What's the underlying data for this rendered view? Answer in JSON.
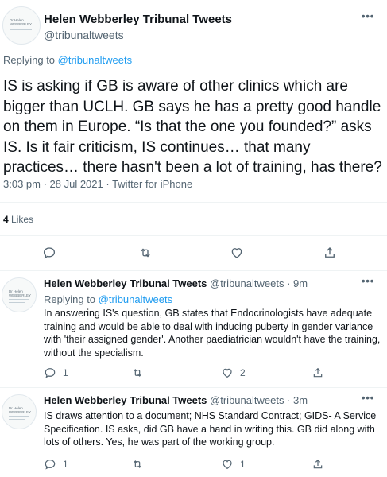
{
  "main_tweet": {
    "author_name": "Helen Webberley Tribunal Tweets",
    "author_handle": "@tribunaltweets",
    "avatar_text": "Dr Helen WEBBERLEY",
    "more_icon": "more-dots-icon",
    "replying_prefix": "Replying to",
    "replying_to": "@tribunaltweets",
    "text": "IS is asking if GB is aware of other clinics which are bigger than UCLH. GB says he has a pretty good handle on them in Europe. “Is that the one you founded?” asks IS. Is it fair criticism, IS continues… that many practices… there hasn't been a lot of training, has there?",
    "timestamp": "3:03 pm · 28 Jul 2021 · Twitter for iPhone",
    "likes_count": "4",
    "likes_label": "Likes",
    "actions": [
      "reply-icon",
      "retweet-icon",
      "like-icon",
      "share-icon"
    ]
  },
  "replies": [
    {
      "author_name": "Helen Webberley Tribunal Tweets",
      "author_handle": "@tribunaltweets",
      "time": "· 9m",
      "avatar_text": "Dr Helen WEBBERLEY",
      "replying_prefix": "Replying to",
      "replying_to": "@tribunaltweets",
      "text": "In answering IS's question, GB states that Endocrinologists have  adequate training and would be able to deal with inducing puberty in gender variance with 'their assigned gender'. Another paediatrician wouldn't have the training, without the specialism.",
      "reply_count": "1",
      "retweet_count": "",
      "like_count": "2"
    },
    {
      "author_name": "Helen Webberley Tribunal Tweets",
      "author_handle": "@tribunaltweets",
      "time": "· 3m",
      "avatar_text": "Dr Helen WEBBERLEY",
      "text": "IS draws attention to a document; NHS Standard Contract; GIDS- A Service Specification. IS asks, did GB have a hand in writing this. GB did along with lots of others. Yes, he was part of the working group.",
      "reply_count": "1",
      "retweet_count": "",
      "like_count": "1"
    }
  ],
  "colors": {
    "accent": "#1d9bf0",
    "text": "#0f1419",
    "muted": "#536471",
    "divider": "#eff3f4"
  }
}
